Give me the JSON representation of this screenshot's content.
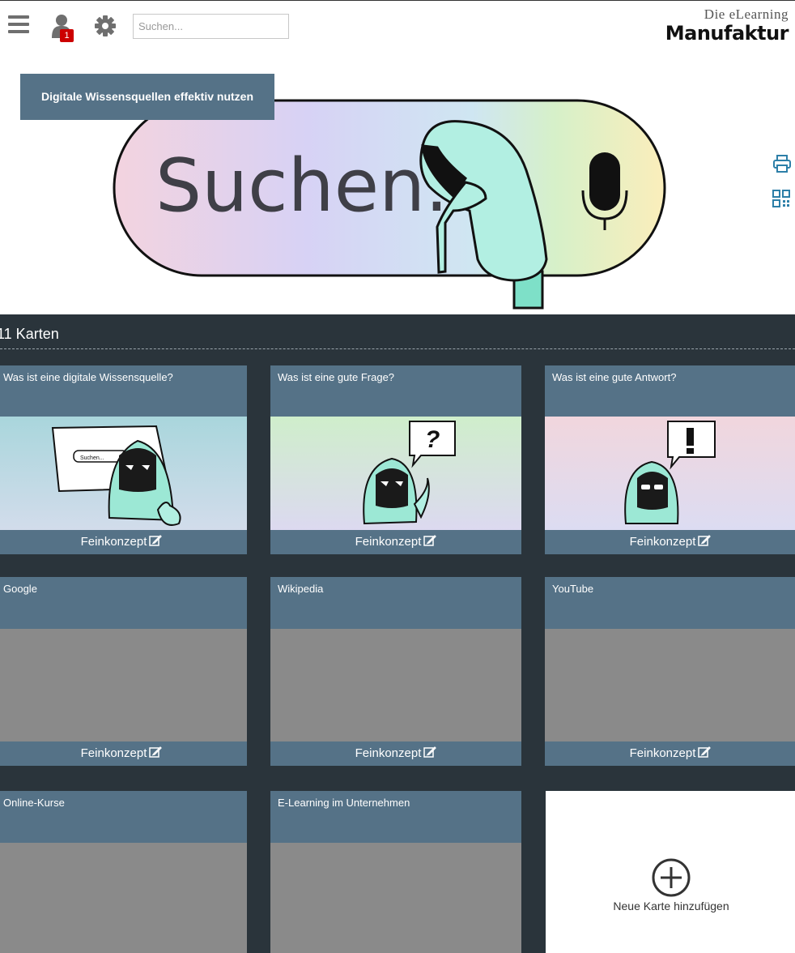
{
  "header": {
    "search_placeholder": "Suchen...",
    "notification_count": "1",
    "logo_small": "Die eLearning",
    "logo_big": "Manufaktur"
  },
  "hero": {
    "title": "Digitale Wissensquellen effektiv nutzen",
    "search_art_text": "Suchen..."
  },
  "cards_section": {
    "count_label": "11 Karten",
    "footer_label": "Feinkonzept",
    "add_label": "Neue Karte hinzufügen",
    "mini_search_text": "Suchen...",
    "cards": [
      {
        "title": "Was ist eine digitale Wissensquelle?"
      },
      {
        "title": "Was ist eine gute Frage?"
      },
      {
        "title": "Was ist eine gute Antwort?"
      },
      {
        "title": "Google"
      },
      {
        "title": "Wikipedia"
      },
      {
        "title": "YouTube"
      },
      {
        "title": "Online-Kurse"
      },
      {
        "title": "E-Learning im Unternehmen"
      }
    ]
  },
  "colors": {
    "header_blue": "#557287",
    "dark_bg": "#2a343b",
    "mint": "#b2efe2",
    "badge_red": "#cc0000"
  },
  "icons": [
    "menu-icon",
    "user-icon",
    "gear-icon",
    "print-icon",
    "qr-code-icon",
    "edit-icon",
    "add-circle-icon",
    "microphone-icon"
  ]
}
